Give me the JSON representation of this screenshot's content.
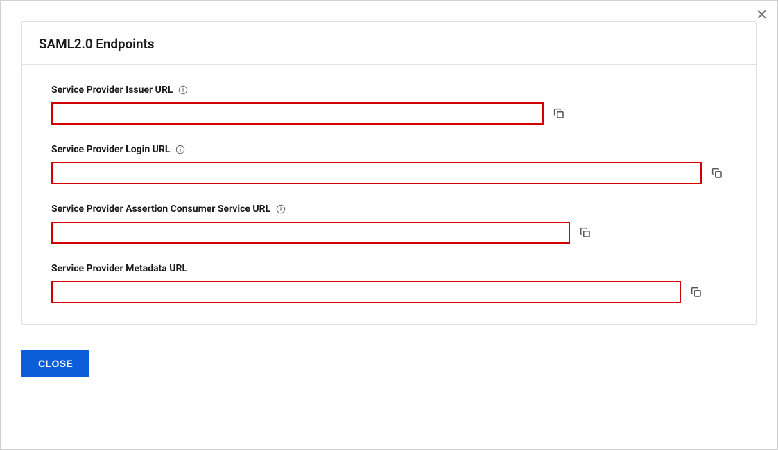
{
  "modal": {
    "close_x": "✕"
  },
  "card": {
    "title": "SAML2.0 Endpoints"
  },
  "fields": {
    "issuer": {
      "label": "Service Provider Issuer URL",
      "value": "",
      "has_info": true
    },
    "login": {
      "label": "Service Provider Login URL",
      "value": "",
      "has_info": true
    },
    "acs": {
      "label": "Service Provider Assertion Consumer Service URL",
      "value": "",
      "has_info": true
    },
    "metadata": {
      "label": "Service Provider Metadata URL",
      "value": "",
      "has_info": false
    }
  },
  "footer": {
    "close_label": "CLOSE"
  }
}
